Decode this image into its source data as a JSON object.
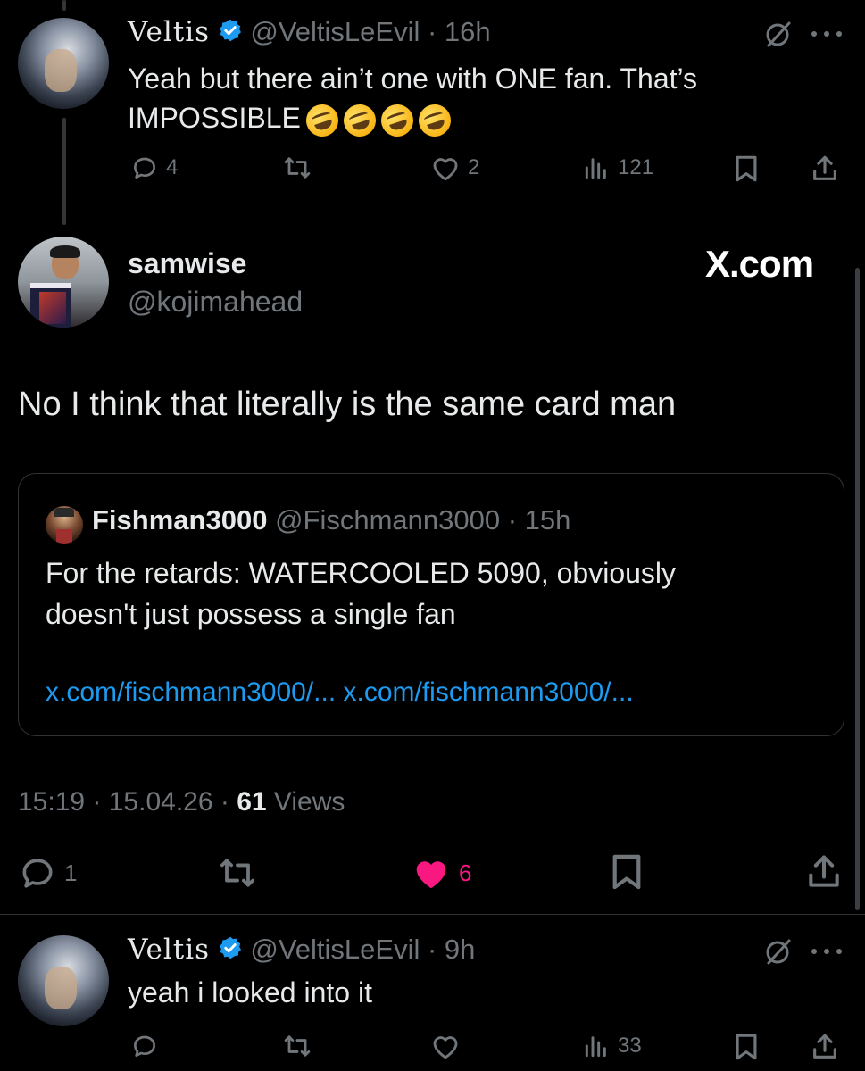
{
  "tweet1": {
    "name": "Veltis",
    "handle": "@VeltisLeEvil",
    "time": "16h",
    "text_line1": "Yeah but there ain’t one with ONE fan. That’s",
    "text_line2": "IMPOSSIBLE",
    "emojis": [
      "rolling-on-floor-laughing",
      "rolling-on-floor-laughing",
      "rolling-on-floor-laughing",
      "rolling-on-floor-laughing"
    ],
    "replies": "4",
    "likes": "2",
    "views": "121"
  },
  "main_tweet": {
    "name": "samwise",
    "handle": "@kojimahead",
    "watermark": "X.com",
    "text": "No I think that literally is the same card man",
    "timestamp_time": "15:19",
    "timestamp_date": "15.04.26",
    "views_count": "61",
    "views_label": "Views",
    "replies": "1",
    "likes": "6"
  },
  "quote": {
    "name": "Fishman3000",
    "handle": "@Fischmann3000",
    "time": "15h",
    "text_line1": "For the retards: WATERCOOLED 5090, obviously",
    "text_line2": "doesn't just possess a single fan",
    "link1": "x.com/fischmann3000/...",
    "link2": "x.com/fischmann3000/..."
  },
  "tweet3": {
    "name": "Veltis",
    "handle": "@VeltisLeEvil",
    "time": "9h",
    "text": "yeah i looked into it",
    "views": "33"
  },
  "colors": {
    "background": "#000000",
    "text": "#e7e9ea",
    "muted": "#71767b",
    "link": "#1d9bf0",
    "like_active": "#f91880",
    "verified": "#1d9bf0"
  }
}
